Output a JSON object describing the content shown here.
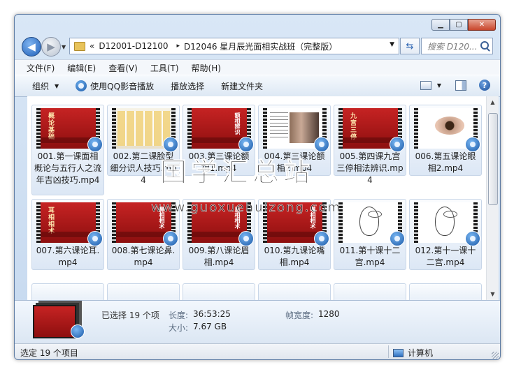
{
  "window": {
    "buttons": {
      "min": "▁",
      "max": "▢",
      "close": "✕"
    }
  },
  "nav": {
    "back_icon": "back-arrow-icon",
    "forward_icon": "forward-arrow-icon",
    "breadcrumb": [
      "«",
      "D12001-D12100",
      "▸",
      "D12046 星月辰光面相实战班（完整版）"
    ],
    "search_placeholder": "搜索 D120..."
  },
  "menu": [
    "文件(F)",
    "编辑(E)",
    "查看(V)",
    "工具(T)",
    "帮助(H)"
  ],
  "toolbar": {
    "organize": "组织",
    "play_qq": "使用QQ影音播放",
    "play_select": "播放选择",
    "new_folder": "新建文件夹"
  },
  "files": [
    {
      "name": "001.第一课面相概论与五行人之流年吉凶技巧.mp4",
      "thumb_title": "概论基础"
    },
    {
      "name": "002.第二课脸型细分识人技巧.mp4",
      "thumb_title": ""
    },
    {
      "name": "003.第三课论额相1.mp4",
      "thumb_title": "额相辨识"
    },
    {
      "name": "004.第三课论额相2.mp4",
      "thumb_title": ""
    },
    {
      "name": "005.第四课九宫三停相法辨识.mp4",
      "thumb_title": "九宫三停"
    },
    {
      "name": "006.第五课论眼相2.mp4",
      "thumb_title": ""
    },
    {
      "name": "007.第六课论耳.mp4",
      "thumb_title": "耳相相术"
    },
    {
      "name": "008.第七课论鼻.mp4",
      "thumb_title": "鼻相相术"
    },
    {
      "name": "009.第八课论眉相.mp4",
      "thumb_title": "眉相相术"
    },
    {
      "name": "010.第九课论嘴相.mp4",
      "thumb_title": "嘴相相术"
    },
    {
      "name": "011.第十课十二宫.mp4",
      "thumb_title": ""
    },
    {
      "name": "012.第十一课十二宫.mp4",
      "thumb_title": ""
    }
  ],
  "watermark": {
    "text": "国学汇总站",
    "url": "www.guoxuehuizong.com"
  },
  "details": {
    "selected": "已选择 19 个项",
    "length_label": "长度:",
    "length_value": "36:53:25",
    "size_label": "大小:",
    "size_value": "7.67 GB",
    "width_label": "帧宽度:",
    "width_value": "1280"
  },
  "status": {
    "left": "选定 19 个项目",
    "right": "计算机"
  },
  "colors": {
    "accent": "#1f5fb8",
    "thumb_red": "#c62323"
  }
}
